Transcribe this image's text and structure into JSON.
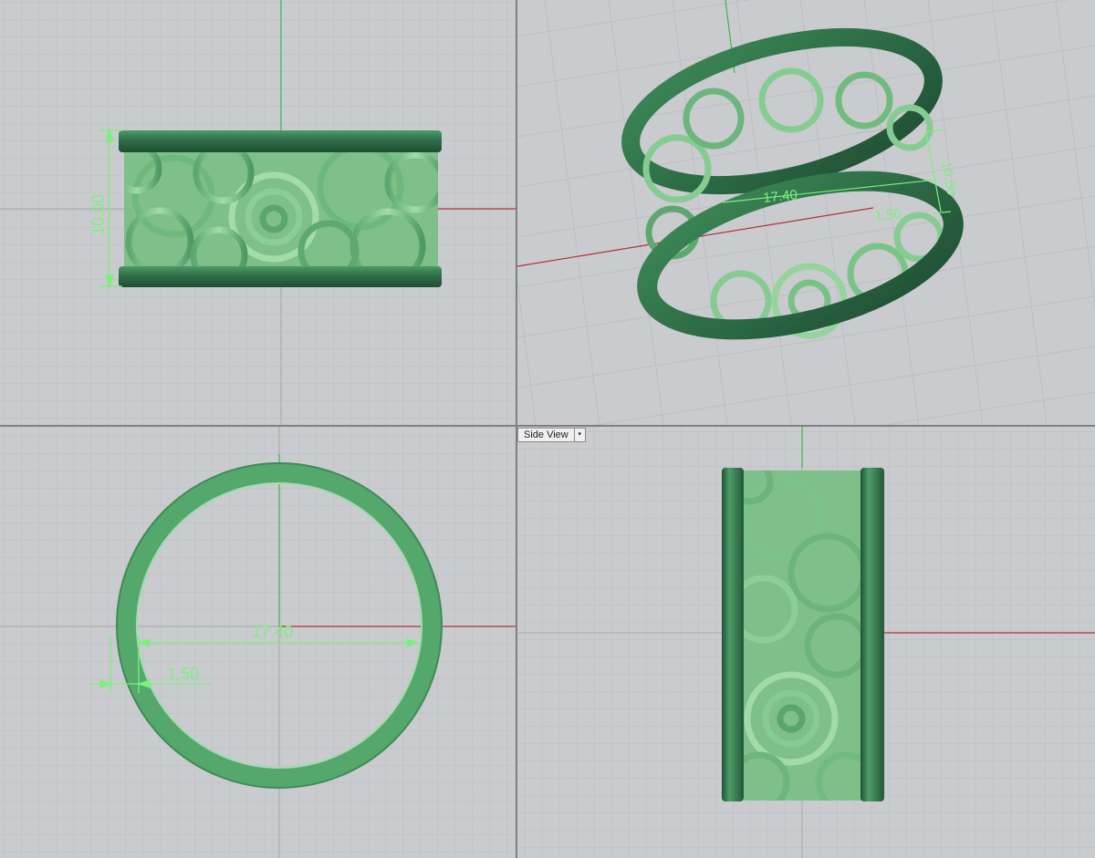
{
  "viewports": {
    "top_left": {
      "height_dim": "10.00"
    },
    "top_right": {
      "diameter_dim": "17.40",
      "width_dim": "1.50",
      "height_dim": "10.00"
    },
    "bottom_left": {
      "diameter_dim": "17.40",
      "width_dim": "1.50"
    },
    "bottom_right": {
      "label": "Side View",
      "menu_arrow": "▾"
    }
  },
  "colors": {
    "viewport_bg": "#c9cbce",
    "grid_minor": "#bcbec1",
    "grid_major": "#a5a7ab",
    "x_axis": "#b5303a",
    "y_axis": "#3db54a",
    "ring_dark": "#2f6e48",
    "ring_light": "#78c48a",
    "dimension": "#7cf07c"
  }
}
